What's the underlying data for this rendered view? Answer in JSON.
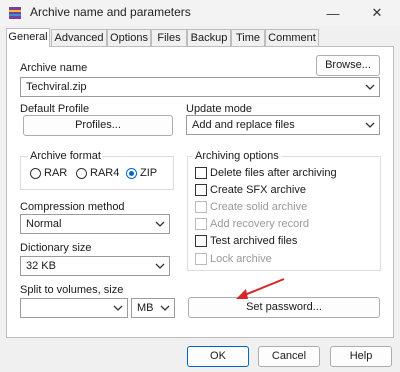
{
  "window": {
    "title": "Archive name and parameters",
    "min_icon": "minimize-icon",
    "close_icon": "close-icon"
  },
  "tabs": [
    "General",
    "Advanced",
    "Options",
    "Files",
    "Backup",
    "Time",
    "Comment"
  ],
  "active_tab": "General",
  "archive_name": {
    "label": "Archive name",
    "value": "Techviral.zip",
    "browse": "Browse..."
  },
  "default_profile": {
    "label": "Default Profile",
    "button": "Profiles..."
  },
  "update_mode": {
    "label": "Update mode",
    "value": "Add and replace files"
  },
  "archive_format": {
    "label": "Archive format",
    "options": [
      "RAR",
      "RAR4",
      "ZIP"
    ],
    "selected": "ZIP"
  },
  "archiving_options": {
    "label": "Archiving options",
    "items": [
      {
        "label": "Delete files after archiving",
        "enabled": true,
        "checked": false
      },
      {
        "label": "Create SFX archive",
        "enabled": true,
        "checked": false
      },
      {
        "label": "Create solid archive",
        "enabled": false,
        "checked": false
      },
      {
        "label": "Add recovery record",
        "enabled": false,
        "checked": false
      },
      {
        "label": "Test archived files",
        "enabled": true,
        "checked": false
      },
      {
        "label": "Lock archive",
        "enabled": false,
        "checked": false
      }
    ]
  },
  "compression_method": {
    "label": "Compression method",
    "value": "Normal"
  },
  "dictionary_size": {
    "label": "Dictionary size",
    "value": "32 KB"
  },
  "split": {
    "label": "Split to volumes, size",
    "value": "",
    "unit": "MB"
  },
  "set_password": "Set password...",
  "footer": {
    "ok": "OK",
    "cancel": "Cancel",
    "help": "Help"
  },
  "colors": {
    "accent": "#0067c0",
    "arrow": "#d62828"
  }
}
